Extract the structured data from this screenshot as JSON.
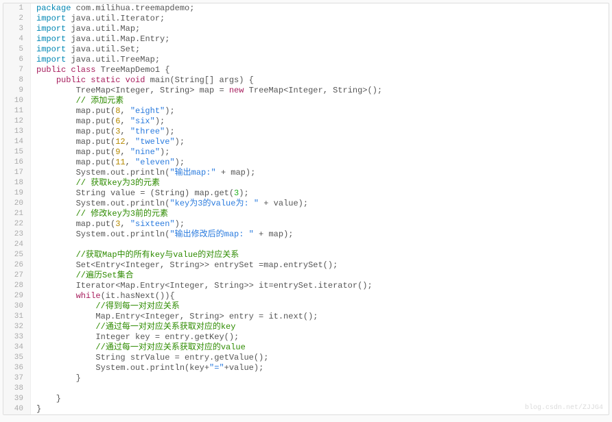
{
  "watermark": "blog.csdn.net/ZJJG4",
  "lines": [
    {
      "n": 1,
      "segs": [
        {
          "t": "package ",
          "c": "kw-pkg"
        },
        {
          "t": "com.milihua.treemapdemo;",
          "c": "plain"
        }
      ]
    },
    {
      "n": 2,
      "segs": [
        {
          "t": "import ",
          "c": "kw-pkg"
        },
        {
          "t": "java.util.Iterator;",
          "c": "plain"
        }
      ]
    },
    {
      "n": 3,
      "segs": [
        {
          "t": "import ",
          "c": "kw-pkg"
        },
        {
          "t": "java.util.Map;",
          "c": "plain"
        }
      ]
    },
    {
      "n": 4,
      "segs": [
        {
          "t": "import ",
          "c": "kw-pkg"
        },
        {
          "t": "java.util.Map.Entry;",
          "c": "plain"
        }
      ]
    },
    {
      "n": 5,
      "segs": [
        {
          "t": "import ",
          "c": "kw-pkg"
        },
        {
          "t": "java.util.Set;",
          "c": "plain"
        }
      ]
    },
    {
      "n": 6,
      "segs": [
        {
          "t": "import ",
          "c": "kw-pkg"
        },
        {
          "t": "java.util.TreeMap;",
          "c": "plain"
        }
      ]
    },
    {
      "n": 7,
      "segs": [
        {
          "t": "public class ",
          "c": "kw-mod"
        },
        {
          "t": "TreeMapDemo1 ",
          "c": "plain"
        },
        {
          "t": "{",
          "c": "plain"
        }
      ]
    },
    {
      "n": 8,
      "segs": [
        {
          "t": "    ",
          "c": "plain"
        },
        {
          "t": "public static void ",
          "c": "kw-mod"
        },
        {
          "t": "main(String[] args) {",
          "c": "plain"
        }
      ]
    },
    {
      "n": 9,
      "segs": [
        {
          "t": "        TreeMap<Integer, String> map = ",
          "c": "plain"
        },
        {
          "t": "new ",
          "c": "kw-mod"
        },
        {
          "t": "TreeMap<Integer, String>();",
          "c": "plain"
        }
      ]
    },
    {
      "n": 10,
      "segs": [
        {
          "t": "        ",
          "c": "plain"
        },
        {
          "t": "// 添加元素",
          "c": "comment"
        }
      ]
    },
    {
      "n": 11,
      "segs": [
        {
          "t": "        map.put(",
          "c": "plain"
        },
        {
          "t": "8",
          "c": "num"
        },
        {
          "t": ", ",
          "c": "plain"
        },
        {
          "t": "\"eight\"",
          "c": "str2"
        },
        {
          "t": ");",
          "c": "plain"
        }
      ]
    },
    {
      "n": 12,
      "segs": [
        {
          "t": "        map.put(",
          "c": "plain"
        },
        {
          "t": "6",
          "c": "num"
        },
        {
          "t": ", ",
          "c": "plain"
        },
        {
          "t": "\"six\"",
          "c": "str2"
        },
        {
          "t": ");",
          "c": "plain"
        }
      ]
    },
    {
      "n": 13,
      "segs": [
        {
          "t": "        map.put(",
          "c": "plain"
        },
        {
          "t": "3",
          "c": "num"
        },
        {
          "t": ", ",
          "c": "plain"
        },
        {
          "t": "\"three\"",
          "c": "str2"
        },
        {
          "t": ");",
          "c": "plain"
        }
      ]
    },
    {
      "n": 14,
      "segs": [
        {
          "t": "        map.put(",
          "c": "plain"
        },
        {
          "t": "12",
          "c": "num"
        },
        {
          "t": ", ",
          "c": "plain"
        },
        {
          "t": "\"twelve\"",
          "c": "str2"
        },
        {
          "t": ");",
          "c": "plain"
        }
      ]
    },
    {
      "n": 15,
      "segs": [
        {
          "t": "        map.put(",
          "c": "plain"
        },
        {
          "t": "9",
          "c": "num"
        },
        {
          "t": ", ",
          "c": "plain"
        },
        {
          "t": "\"nine\"",
          "c": "str2"
        },
        {
          "t": ");",
          "c": "plain"
        }
      ]
    },
    {
      "n": 16,
      "segs": [
        {
          "t": "        map.put(",
          "c": "plain"
        },
        {
          "t": "11",
          "c": "num"
        },
        {
          "t": ", ",
          "c": "plain"
        },
        {
          "t": "\"eleven\"",
          "c": "str2"
        },
        {
          "t": ");",
          "c": "plain"
        }
      ]
    },
    {
      "n": 17,
      "segs": [
        {
          "t": "        System.out.println(",
          "c": "plain"
        },
        {
          "t": "\"输出map:\"",
          "c": "str2"
        },
        {
          "t": " + map);",
          "c": "plain"
        }
      ]
    },
    {
      "n": 18,
      "segs": [
        {
          "t": "        ",
          "c": "plain"
        },
        {
          "t": "// 获取key为3的元素",
          "c": "comment"
        }
      ]
    },
    {
      "n": 19,
      "segs": [
        {
          "t": "        String value = (String) map.get(",
          "c": "plain"
        },
        {
          "t": "3",
          "c": "numg"
        },
        {
          "t": ");",
          "c": "plain"
        }
      ]
    },
    {
      "n": 20,
      "segs": [
        {
          "t": "        System.out.println(",
          "c": "plain"
        },
        {
          "t": "\"key为3的value为: \"",
          "c": "str2"
        },
        {
          "t": " + value);",
          "c": "plain"
        }
      ]
    },
    {
      "n": 21,
      "segs": [
        {
          "t": "        ",
          "c": "plain"
        },
        {
          "t": "// 修改key为3前的元素",
          "c": "comment"
        }
      ]
    },
    {
      "n": 22,
      "segs": [
        {
          "t": "        map.put(",
          "c": "plain"
        },
        {
          "t": "3",
          "c": "num"
        },
        {
          "t": ", ",
          "c": "plain"
        },
        {
          "t": "\"sixteen\"",
          "c": "str2"
        },
        {
          "t": ");",
          "c": "plain"
        }
      ]
    },
    {
      "n": 23,
      "segs": [
        {
          "t": "        System.out.println(",
          "c": "plain"
        },
        {
          "t": "\"输出修改后的map: \"",
          "c": "str2"
        },
        {
          "t": " + map);",
          "c": "plain"
        }
      ]
    },
    {
      "n": 24,
      "segs": [
        {
          "t": "",
          "c": "plain"
        }
      ]
    },
    {
      "n": 25,
      "segs": [
        {
          "t": "        ",
          "c": "plain"
        },
        {
          "t": "//获取Map中的所有key与value的对应关系",
          "c": "comment"
        }
      ]
    },
    {
      "n": 26,
      "segs": [
        {
          "t": "        Set<Entry<Integer, String>> entrySet =map.entrySet();",
          "c": "plain"
        }
      ]
    },
    {
      "n": 27,
      "segs": [
        {
          "t": "        ",
          "c": "plain"
        },
        {
          "t": "//遍历Set集合",
          "c": "comment"
        }
      ]
    },
    {
      "n": 28,
      "segs": [
        {
          "t": "        Iterator<Map.Entry<Integer, String>> it=entrySet.iterator();",
          "c": "plain"
        }
      ]
    },
    {
      "n": 29,
      "segs": [
        {
          "t": "        ",
          "c": "plain"
        },
        {
          "t": "while",
          "c": "kw-mod"
        },
        {
          "t": "(it.hasNext()){",
          "c": "plain"
        }
      ]
    },
    {
      "n": 30,
      "segs": [
        {
          "t": "            ",
          "c": "plain"
        },
        {
          "t": "//得到每一对对应关系",
          "c": "comment"
        }
      ]
    },
    {
      "n": 31,
      "segs": [
        {
          "t": "            Map.Entry<Integer, String> entry = it.next();",
          "c": "plain"
        }
      ]
    },
    {
      "n": 32,
      "segs": [
        {
          "t": "            ",
          "c": "plain"
        },
        {
          "t": "//通过每一对对应关系获取对应的key",
          "c": "comment"
        }
      ]
    },
    {
      "n": 33,
      "segs": [
        {
          "t": "            Integer key = entry.getKey();",
          "c": "plain"
        }
      ]
    },
    {
      "n": 34,
      "segs": [
        {
          "t": "            ",
          "c": "plain"
        },
        {
          "t": "//通过每一对对应关系获取对应的value",
          "c": "comment"
        }
      ]
    },
    {
      "n": 35,
      "segs": [
        {
          "t": "            String strValue = entry.getValue();",
          "c": "plain"
        }
      ]
    },
    {
      "n": 36,
      "segs": [
        {
          "t": "            System.out.println(key+",
          "c": "plain"
        },
        {
          "t": "\"=\"",
          "c": "str2"
        },
        {
          "t": "+value);",
          "c": "plain"
        }
      ]
    },
    {
      "n": 37,
      "segs": [
        {
          "t": "        }",
          "c": "plain"
        }
      ]
    },
    {
      "n": 38,
      "segs": [
        {
          "t": "",
          "c": "plain"
        }
      ]
    },
    {
      "n": 39,
      "segs": [
        {
          "t": "    }",
          "c": "plain"
        }
      ]
    },
    {
      "n": 40,
      "segs": [
        {
          "t": "}",
          "c": "plain"
        }
      ]
    }
  ]
}
